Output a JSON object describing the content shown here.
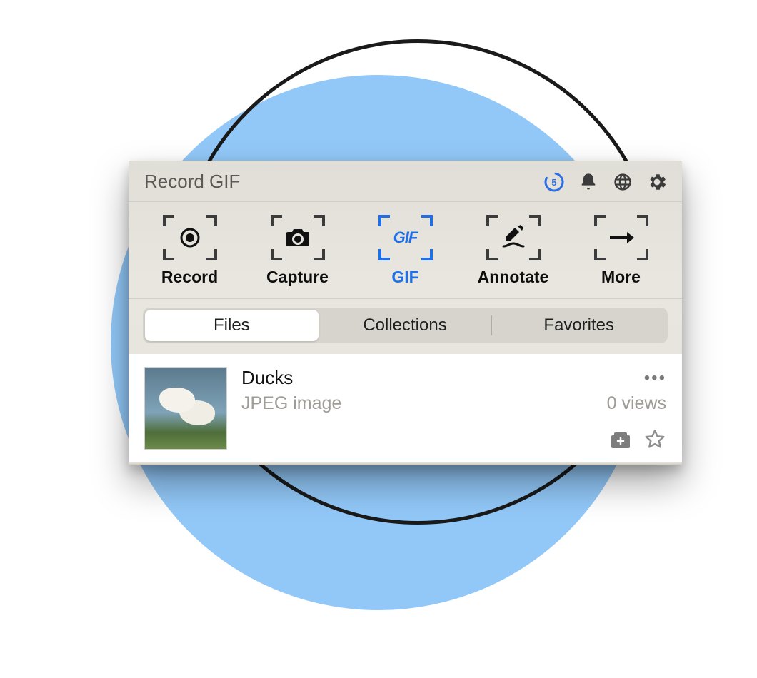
{
  "header": {
    "title": "Record GIF",
    "timer_value": "5"
  },
  "toolbar": {
    "items": [
      {
        "label": "Record"
      },
      {
        "label": "Capture"
      },
      {
        "label": "GIF"
      },
      {
        "label": "Annotate"
      },
      {
        "label": "More"
      }
    ],
    "gif_badge": "GIF"
  },
  "segments": {
    "files": "Files",
    "collections": "Collections",
    "favorites": "Favorites"
  },
  "file": {
    "name": "Ducks",
    "type": "JPEG image",
    "views": "0 views"
  }
}
